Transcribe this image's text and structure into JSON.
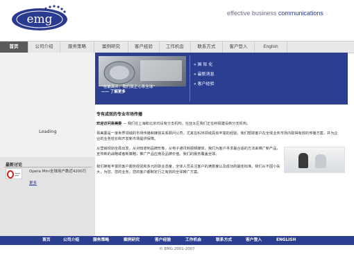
{
  "header": {
    "logo_text": "emg",
    "tagline_plain": "effective business ",
    "tagline_bold": "communications"
  },
  "nav": {
    "items": [
      "首页",
      "公司介绍",
      "服务策略",
      "案例研究",
      "客户经验",
      "工作机会",
      "联系方式",
      "客户登入",
      "English"
    ]
  },
  "banner": {
    "quote_line1": "“在最高点，我们真正心系全球”",
    "quote_line2": "—— 了解更多",
    "links": [
      "国 际 化",
      "最新消息",
      "客户经验"
    ]
  },
  "left": {
    "loading": "Loading",
    "latest_title": "最新讨论",
    "latest_text": "Opera Mini全球用户数近4200万",
    "latest_more": "更多"
  },
  "main": {
    "title": "专有成效的专业市场传播",
    "p1_bold": "欢迎访问易美委",
    "p1": " — 我们在上海和北京均设有分支机构，在亚太区我们正在积极建设新分支机构。",
    "p2": "易美委是一家世界领域的市场传播和媒体关系顾问公司，尤其在B2B领域具有丰富的经验。我们帮助客户在全球业务市场内取得有效的传播方案，并为企业的业务增长和开发新市场提供保障。",
    "p3": "从营销规划全局出发，从对知道到品牌形象，从电子通讯到视频媒体，我们为客户寻求最合适的方法来推广新产品，宣传新的战略或者新策略，推广产品应用及品牌价值。我们的服务覆盖全球。",
    "p4": "我们拥有丰富的客户服务经验和多元的职业态度，全体人员关注客户的满意度以及成功的最佳标准。我们从不因小失大，为您、您的业务，您的客户都制定行之有效的全球推广方案。"
  },
  "footer": {
    "items": [
      "首页",
      "公司介绍",
      "服务策略",
      "案例研究",
      "客户经验",
      "工作机会",
      "联系方式",
      "客户登入",
      "ENGLISH"
    ],
    "copyright": "© EMG 2001-2007"
  },
  "colors": {
    "brand_blue": "#2c3e8f",
    "nav_bg": "#e8e8e8",
    "nav_active": "#5a5a5a"
  }
}
